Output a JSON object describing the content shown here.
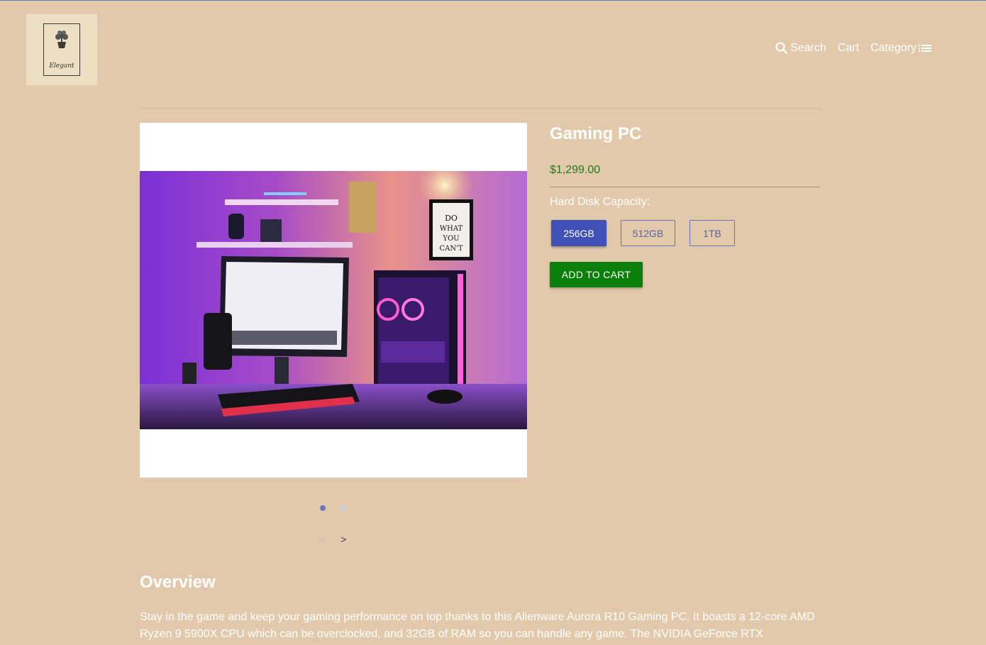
{
  "header": {
    "logo_text": "Elegant",
    "nav": {
      "search_label": "Search",
      "cart_label": "Cart",
      "category_label": "Category"
    }
  },
  "product": {
    "title": "Gaming PC",
    "price": "$1,299.00",
    "option_label": "Hard Disk Capacity:",
    "options": [
      {
        "label": "256GB",
        "selected": true
      },
      {
        "label": "512GB",
        "selected": false
      },
      {
        "label": "1TB",
        "selected": false
      }
    ],
    "add_to_cart_label": "ADD TO CART",
    "image_poster_text": "DO WHAT YOU CAN'T"
  },
  "carousel": {
    "slide_count": 2,
    "active_index": 0,
    "prev_label": "<",
    "next_label": ">"
  },
  "overview": {
    "title": "Overview",
    "text": "Stay in the game and keep your gaming performance on top thanks to this Alienware Aurora R10 Gaming PC. It boasts a 12-core AMD Ryzen 9 5900X CPU which can be overclocked, and 32GB of RAM so you can handle any game. The NVIDIA GeForce RTX"
  },
  "colors": {
    "background": "#e2c9ab",
    "primary": "#3f51b5",
    "add_to_cart": "#0a800a",
    "price": "#1f7a1f"
  }
}
